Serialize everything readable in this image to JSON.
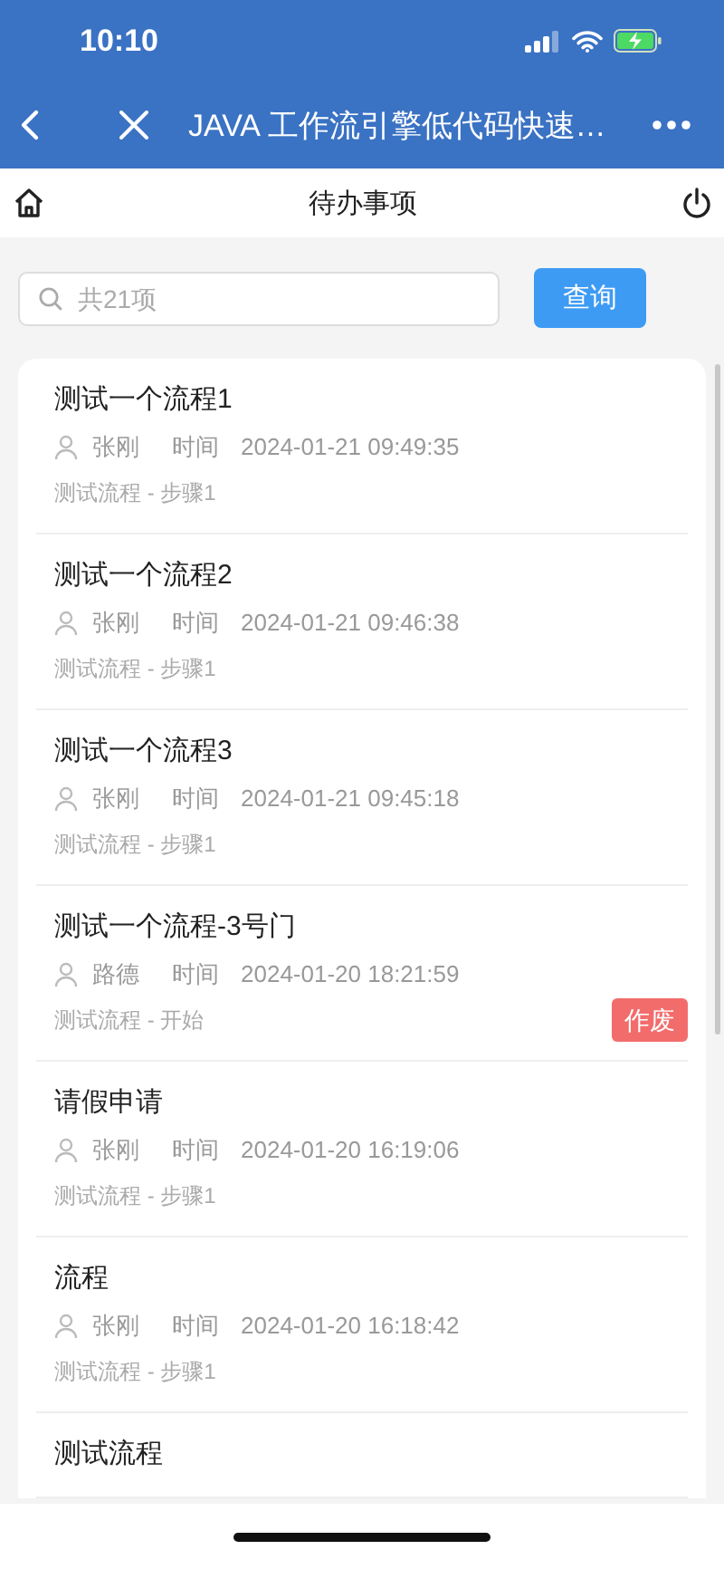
{
  "status_bar": {
    "time": "10:10"
  },
  "nav_bar": {
    "title": "JAVA 工作流引擎低代码快速…"
  },
  "header": {
    "title": "待办事项"
  },
  "search": {
    "placeholder": "共21项",
    "button": "查询"
  },
  "tasks": [
    {
      "title": "测试一个流程1",
      "user": "张刚",
      "time_label": "时间",
      "time": "2024-01-21 09:49:35",
      "step": "测试流程 - 步骤1"
    },
    {
      "title": "测试一个流程2",
      "user": "张刚",
      "time_label": "时间",
      "time": "2024-01-21 09:46:38",
      "step": "测试流程 - 步骤1"
    },
    {
      "title": "测试一个流程3",
      "user": "张刚",
      "time_label": "时间",
      "time": "2024-01-21 09:45:18",
      "step": "测试流程 - 步骤1"
    },
    {
      "title": "测试一个流程-3号门",
      "user": "路德",
      "time_label": "时间",
      "time": "2024-01-20 18:21:59",
      "step": "测试流程 - 开始",
      "action": "作废"
    },
    {
      "title": "请假申请",
      "user": "张刚",
      "time_label": "时间",
      "time": "2024-01-20 16:19:06",
      "step": "测试流程 - 步骤1"
    },
    {
      "title": "流程",
      "user": "张刚",
      "time_label": "时间",
      "time": "2024-01-20 16:18:42",
      "step": "测试流程 - 步骤1"
    },
    {
      "title": "测试流程"
    }
  ]
}
